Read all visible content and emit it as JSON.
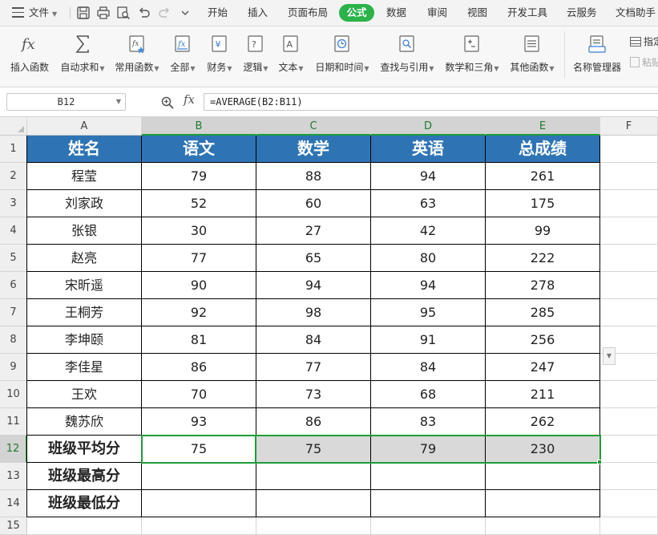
{
  "menubar": {
    "file_label": "文件",
    "tabs": [
      "开始",
      "插入",
      "页面布局",
      "公式",
      "数据",
      "审阅",
      "视图",
      "开发工具",
      "云服务",
      "文档助手"
    ],
    "active_tab": "公式"
  },
  "ribbon": {
    "buttons": [
      {
        "label": "插入函数",
        "icon": "fx-icon",
        "dropdown": false
      },
      {
        "label": "自动求和",
        "icon": "sigma-icon",
        "dropdown": true
      },
      {
        "label": "常用函数",
        "icon": "star-fx-icon",
        "dropdown": true
      },
      {
        "label": "全部",
        "icon": "all-fx-icon",
        "dropdown": true
      },
      {
        "label": "财务",
        "icon": "yen-icon",
        "dropdown": true
      },
      {
        "label": "逻辑",
        "icon": "question-icon",
        "dropdown": true
      },
      {
        "label": "文本",
        "icon": "text-a-icon",
        "dropdown": true
      },
      {
        "label": "日期和时间",
        "icon": "clock-icon",
        "dropdown": true
      },
      {
        "label": "查找与引用",
        "icon": "lookup-icon",
        "dropdown": true
      },
      {
        "label": "数学和三角",
        "icon": "math-icon",
        "dropdown": true
      },
      {
        "label": "其他函数",
        "icon": "more-fx-icon",
        "dropdown": true
      },
      {
        "label": "名称管理器",
        "icon": "name-manager-icon",
        "dropdown": false
      }
    ],
    "side_buttons": [
      {
        "label": "指定",
        "icon": "assign-icon"
      },
      {
        "label": "粘贴",
        "icon": "paste-icon"
      }
    ]
  },
  "formula_bar": {
    "cell_ref": "B12",
    "fx_label": "fx",
    "formula": "=AVERAGE(B2:B11)"
  },
  "columns": [
    "A",
    "B",
    "C",
    "D",
    "E",
    "F"
  ],
  "rows": [
    "1",
    "2",
    "3",
    "4",
    "5",
    "6",
    "7",
    "8",
    "9",
    "10",
    "11",
    "12",
    "13",
    "14",
    "15"
  ],
  "table": {
    "headers": [
      "姓名",
      "语文",
      "数学",
      "英语",
      "总成绩"
    ],
    "students": [
      [
        "程莹",
        "79",
        "88",
        "94",
        "261"
      ],
      [
        "刘家政",
        "52",
        "60",
        "63",
        "175"
      ],
      [
        "张银",
        "30",
        "27",
        "42",
        "99"
      ],
      [
        "赵亮",
        "77",
        "65",
        "80",
        "222"
      ],
      [
        "宋昕遥",
        "90",
        "94",
        "94",
        "278"
      ],
      [
        "王桐芳",
        "92",
        "98",
        "95",
        "285"
      ],
      [
        "李坤颐",
        "81",
        "84",
        "91",
        "256"
      ],
      [
        "李佳星",
        "86",
        "77",
        "84",
        "247"
      ],
      [
        "王欢",
        "70",
        "73",
        "68",
        "211"
      ],
      [
        "魏苏欣",
        "93",
        "86",
        "83",
        "262"
      ]
    ],
    "summary": [
      [
        "班级平均分",
        "75",
        "75",
        "79",
        "230"
      ],
      [
        "班级最高分",
        "",
        "",
        "",
        ""
      ],
      [
        "班级最低分",
        "",
        "",
        "",
        ""
      ]
    ]
  },
  "colors": {
    "header_fill": "#2e74b5",
    "selection_green": "#1d9c3a",
    "active_tab": "#2bb34a",
    "range_fill": "#d9d9d9"
  }
}
